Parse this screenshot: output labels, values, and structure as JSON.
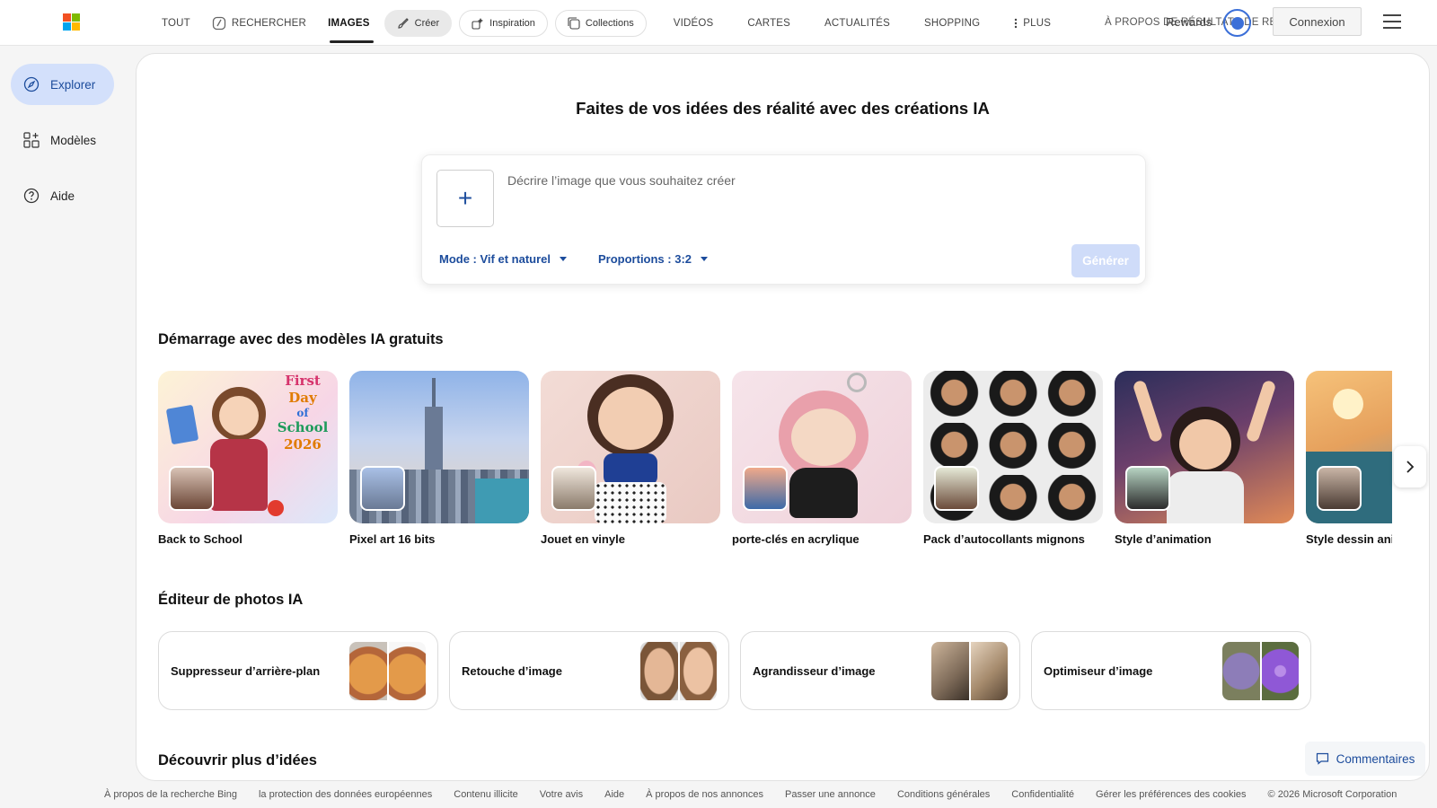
{
  "nav": {
    "items": [
      {
        "label": "TOUT"
      },
      {
        "label": "RECHERCHER"
      },
      {
        "label": "IMAGES"
      }
    ],
    "pills": [
      {
        "label": "Créer"
      },
      {
        "label": "Inspiration"
      },
      {
        "label": "Collections"
      }
    ],
    "more_items": [
      {
        "label": "VIDÉOS"
      },
      {
        "label": "CARTES"
      },
      {
        "label": "ACTUALITÉS"
      },
      {
        "label": "SHOPPING"
      },
      {
        "label": "PLUS"
      },
      {
        "label": "À PROPOS DE RÉSULTATS DE RECHERCHE"
      }
    ],
    "rewards": "Rewards",
    "signin": "Connexion"
  },
  "sidebar": {
    "items": [
      {
        "label": "Explorer"
      },
      {
        "label": "Modèles"
      },
      {
        "label": "Aide"
      }
    ]
  },
  "main": {
    "headline": "Faites de vos idées des réalité avec des créations IA",
    "prompt_placeholder": "Décrire l’image que vous souhaitez créer",
    "mode": "Mode : Vif et naturel",
    "ratio": "Proportions : 3:2",
    "generate": "Générer",
    "templates_title": "Démarrage avec des modèles IA gratuits",
    "templates": [
      {
        "label": "Back to School",
        "overlay": [
          "First",
          "Day",
          "of",
          "School",
          "2026"
        ]
      },
      {
        "label": "Pixel art 16 bits"
      },
      {
        "label": "Jouet en vinyle"
      },
      {
        "label": "porte-clés en acrylique"
      },
      {
        "label": "Pack d’autocollants mignons"
      },
      {
        "label": "Style d’animation"
      },
      {
        "label": "Style dessin animé"
      }
    ],
    "editor_title": "Éditeur de photos IA",
    "editors": [
      {
        "label": "Suppresseur d’arrière-plan"
      },
      {
        "label": "Retouche d’image"
      },
      {
        "label": "Agrandisseur d’image"
      },
      {
        "label": "Optimiseur d’image"
      }
    ],
    "discover_title": "Découvrir plus d’idées"
  },
  "feedback": "Commentaires",
  "footer": {
    "links": [
      {
        "label": "À propos de la recherche Bing"
      },
      {
        "label": "la protection des données européennes"
      },
      {
        "label": "Contenu illicite"
      },
      {
        "label": "Votre avis"
      },
      {
        "label": "Aide"
      },
      {
        "label": "À propos de nos annonces"
      },
      {
        "label": "Passer une annonce"
      },
      {
        "label": "Conditions générales"
      },
      {
        "label": "Confidentialité"
      },
      {
        "label": "Gérer les préférences des cookies"
      },
      {
        "label": "© 2026 Microsoft Corporation"
      }
    ]
  },
  "colors": {
    "accent": "#1c4c9c",
    "sidebar_active_bg": "#d3e0fb",
    "generate_disabled_bg": "#cfdcf9",
    "ms_red": "#f25022",
    "ms_green": "#7fba00",
    "ms_blue": "#00a4ef",
    "ms_yellow": "#ffb900"
  },
  "icons": {
    "search": "search-icon",
    "create": "brush-icon",
    "inspiration": "sparkle-icon",
    "collections": "collections-icon",
    "more": "more-vertical-icon",
    "explore": "compass-icon",
    "templates": "templates-icon",
    "help": "help-icon",
    "feedback": "comment-icon",
    "next": "chevron-right-icon"
  }
}
